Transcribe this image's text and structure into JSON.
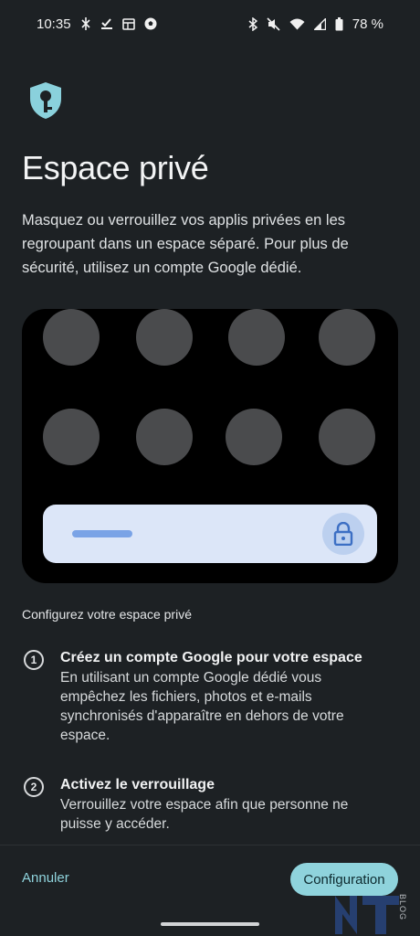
{
  "status_bar": {
    "time": "10:35",
    "left_icons": [
      "nfc-icon",
      "checkbox-icon",
      "calendar-icon",
      "soccer-ball-icon"
    ],
    "right_icons": [
      "bluetooth-icon",
      "mute-icon",
      "wifi-icon",
      "signal-icon",
      "battery-icon"
    ],
    "battery": "78 %"
  },
  "header": {
    "icon": "shield-key-icon",
    "title": "Espace privé",
    "description": "Masquez ou verrouillez vos applis privées en les regroupant dans un espace séparé. Pour plus de sécurité, utilisez un compte Google dédié."
  },
  "illustration": {
    "placeholder_apps": 8,
    "lock_icon": "lock-icon"
  },
  "setup": {
    "section_label": "Configurez votre espace privé",
    "steps": [
      {
        "number": "1",
        "title": "Créez un compte Google pour votre espace",
        "text": "En utilisant un compte Google dédié vous empêchez les fichiers, photos et e-mails synchronisés d'apparaître en dehors de votre espace."
      },
      {
        "number": "2",
        "title": "Activez le verrouillage",
        "text": "Verrouillez votre espace afin que personne ne puisse y accéder."
      }
    ]
  },
  "footer": {
    "cancel_label": "Annuler",
    "config_label": "Configuration"
  },
  "watermark": {
    "text": "BLOG"
  },
  "colors": {
    "background": "#1d2124",
    "accent": "#8fd3dc",
    "illustration_bg": "#000000",
    "lockbar": "#dce6f8"
  }
}
